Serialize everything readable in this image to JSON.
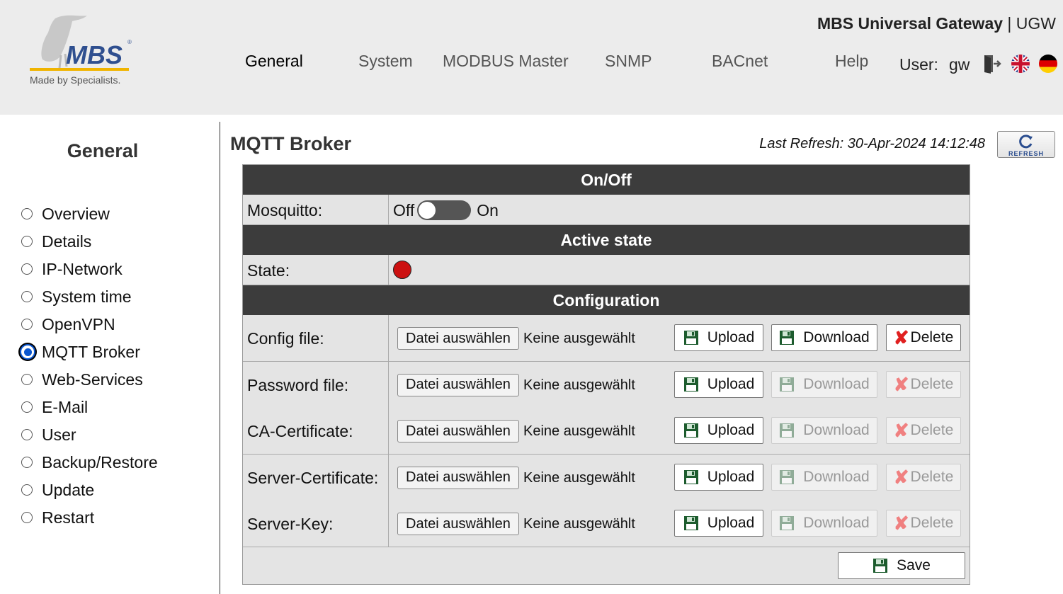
{
  "header": {
    "app_title_bold": "MBS Universal Gateway",
    "app_title_rest": " | UGW",
    "logo_text": "MBS",
    "logo_tagline": "Made by Specialists.",
    "nav": [
      "General",
      "System",
      "MODBUS Master",
      "SNMP",
      "BACnet",
      "Help"
    ],
    "active_nav": "General",
    "user_label": "User:",
    "user_name": "gw"
  },
  "sidebar": {
    "title": "General",
    "items": [
      "Overview",
      "Details",
      "IP-Network",
      "System time",
      "OpenVPN",
      "MQTT Broker",
      "Web-Services",
      "E-Mail",
      "User",
      "Backup/Restore",
      "Update",
      "Restart"
    ],
    "selected": "MQTT Broker"
  },
  "main": {
    "title": "MQTT Broker",
    "last_refresh": "Last Refresh: 30-Apr-2024 14:12:48",
    "refresh_label": "REFRESH",
    "sections": {
      "onoff": "On/Off",
      "active": "Active state",
      "config": "Configuration"
    },
    "mosquitto_label": "Mosquitto:",
    "toggle_off": "Off",
    "toggle_on": "On",
    "state_label": "State:",
    "file_button": "Datei auswählen",
    "no_file": "Keine ausgewählt",
    "upload": "Upload",
    "download": "Download",
    "delete": "Delete",
    "save": "Save",
    "files": [
      {
        "label": "Config file:",
        "download_enabled": true,
        "delete_enabled": true
      },
      {
        "label": "Password file:",
        "download_enabled": false,
        "delete_enabled": false
      },
      {
        "label": "CA-Certificate:",
        "download_enabled": false,
        "delete_enabled": false
      },
      {
        "label": "Server-Certificate:",
        "download_enabled": false,
        "delete_enabled": false
      },
      {
        "label": "Server-Key:",
        "download_enabled": false,
        "delete_enabled": false
      }
    ]
  },
  "colors": {
    "header_bg": "#ececec",
    "section_bg": "#3c3c3c",
    "state_red": "#cc1111",
    "accent_blue": "#0b57d0"
  }
}
